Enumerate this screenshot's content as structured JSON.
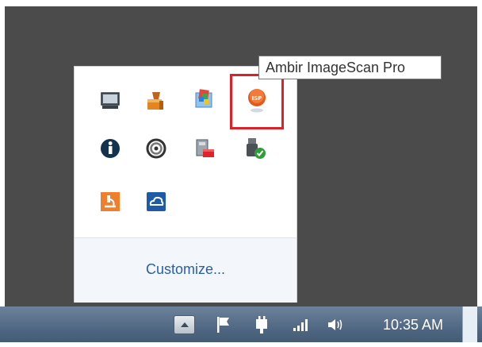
{
  "tooltip": {
    "text": "Ambir ImageScan Pro"
  },
  "flyout": {
    "icons": [
      {
        "name": "monitor-icon"
      },
      {
        "name": "installer-icon"
      },
      {
        "name": "windows-update-icon"
      },
      {
        "name": "ambir-imagescan-pro-icon"
      },
      {
        "name": "info-icon"
      },
      {
        "name": "spiral-icon"
      },
      {
        "name": "network-card-icon"
      },
      {
        "name": "usb-check-icon"
      },
      {
        "name": "microscope-icon"
      },
      {
        "name": "cloud-icon"
      }
    ],
    "customize_label": "Customize..."
  },
  "taskbar": {
    "clock": "10:35 AM",
    "icons": [
      "show-hidden-icons",
      "flag-icon",
      "power-plug-icon",
      "signal-bars-icon",
      "speaker-icon"
    ]
  },
  "colors": {
    "highlight": "#d8232a",
    "link": "#2a5fa8",
    "taskbar": "#4d6580",
    "background": "#4b4b4b"
  }
}
